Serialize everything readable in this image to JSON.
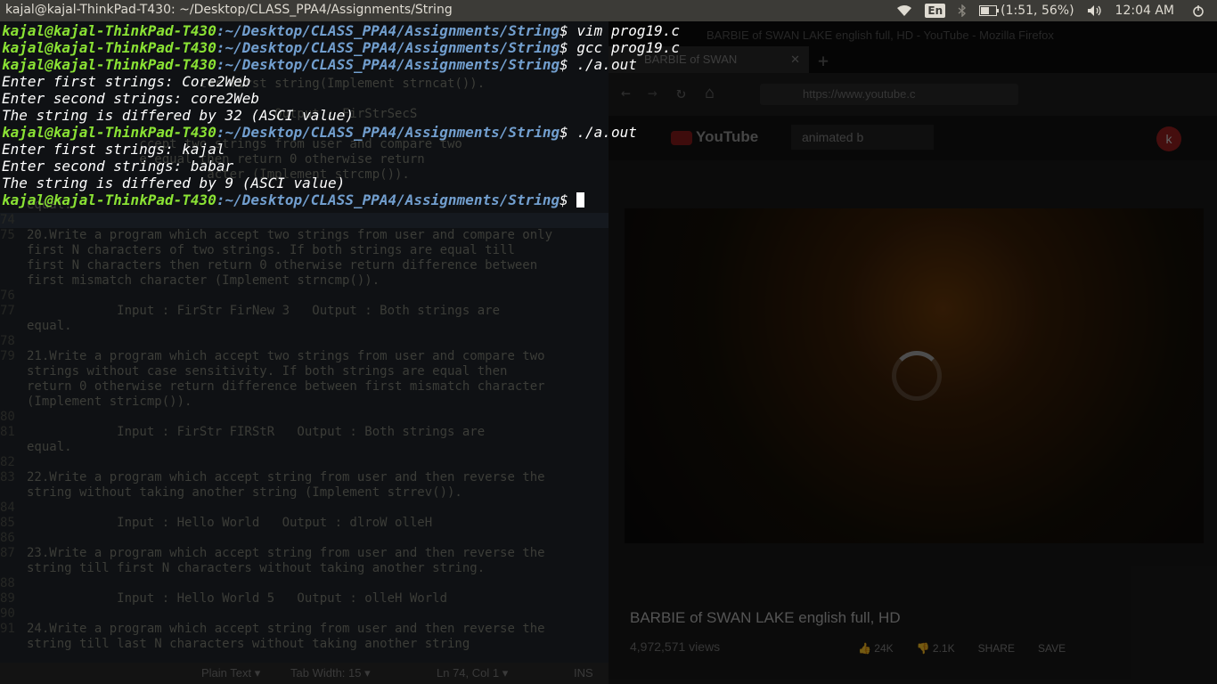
{
  "topbar": {
    "window_title": "kajal@kajal-ThinkPad-T430: ~/Desktop/CLASS_PPA4/Assignments/String",
    "keyboard_lang": "En",
    "battery": "(1:51, 56%)",
    "battery_level": 0.56,
    "clock": "12:04 AM"
  },
  "terminal": {
    "prompt_user": "kajal@kajal-ThinkPad-T430",
    "prompt_path": ":~/Desktop/CLASS_PPA4/Assignments/String",
    "prompt_sign": "$ ",
    "lines": [
      {
        "type": "prompt",
        "cmd": "vim prog19.c"
      },
      {
        "type": "prompt",
        "cmd": "gcc prog19.c"
      },
      {
        "type": "prompt",
        "cmd": "./a.out"
      },
      {
        "type": "output",
        "text": "Enter first strings: Core2Web"
      },
      {
        "type": "output",
        "text": "Enter second strings: core2Web"
      },
      {
        "type": "output",
        "text": "The string is differed by 32 (ASCI value)"
      },
      {
        "type": "prompt",
        "cmd": "./a.out"
      },
      {
        "type": "output",
        "text": "Enter first strings: kajal"
      },
      {
        "type": "output",
        "text": "Enter second strings: babar"
      },
      {
        "type": "output",
        "text": "The string is differed by 9 (ASCI value)"
      },
      {
        "type": "prompt",
        "cmd": ""
      }
    ]
  },
  "editor": {
    "lines": [
      {
        "num": "",
        "text": "                          ter first string(Implement strncat())."
      },
      {
        "num": "",
        "text": ""
      },
      {
        "num": "",
        "text": "                                    Output : FirStrSecS"
      },
      {
        "num": "",
        "text": ""
      },
      {
        "num": "",
        "text": "                  ccept two strings from user and compare two"
      },
      {
        "num": "",
        "text": "                  e equal then return 0 otherwise return"
      },
      {
        "num": "",
        "text": "                           acter (Implement strcmp())."
      },
      {
        "num": "",
        "text": ""
      },
      {
        "num": "",
        "text": "   equal."
      },
      {
        "num": "74",
        "text": ""
      },
      {
        "num": "75",
        "text": "   20.Write a program which accept two strings from user and compare only"
      },
      {
        "num": "",
        "text": "   first N characters of two strings. If both strings are equal till"
      },
      {
        "num": "",
        "text": "   first N characters then return 0 otherwise return difference between"
      },
      {
        "num": "",
        "text": "   first mismatch character (Implement strncmp())."
      },
      {
        "num": "76",
        "text": ""
      },
      {
        "num": "77",
        "text": "               Input : FirStr FirNew 3   Output : Both strings are"
      },
      {
        "num": "",
        "text": "   equal."
      },
      {
        "num": "78",
        "text": ""
      },
      {
        "num": "79",
        "text": "   21.Write a program which accept two strings from user and compare two"
      },
      {
        "num": "",
        "text": "   strings without case sensitivity. If both strings are equal then"
      },
      {
        "num": "",
        "text": "   return 0 otherwise return difference between first mismatch character"
      },
      {
        "num": "",
        "text": "   (Implement stricmp())."
      },
      {
        "num": "80",
        "text": ""
      },
      {
        "num": "81",
        "text": "               Input : FirStr FIRStR   Output : Both strings are"
      },
      {
        "num": "",
        "text": "   equal."
      },
      {
        "num": "82",
        "text": ""
      },
      {
        "num": "83",
        "text": "   22.Write a program which accept string from user and then reverse the"
      },
      {
        "num": "",
        "text": "   string without taking another string (Implement strrev())."
      },
      {
        "num": "84",
        "text": ""
      },
      {
        "num": "85",
        "text": "               Input : Hello World   Output : dlroW olleH"
      },
      {
        "num": "86",
        "text": ""
      },
      {
        "num": "87",
        "text": "   23.Write a program which accept string from user and then reverse the"
      },
      {
        "num": "",
        "text": "   string till first N characters without taking another string."
      },
      {
        "num": "88",
        "text": ""
      },
      {
        "num": "89",
        "text": "               Input : Hello World 5   Output : olleH World"
      },
      {
        "num": "90",
        "text": ""
      },
      {
        "num": "91",
        "text": "   24.Write a program which accept string from user and then reverse the"
      },
      {
        "num": "",
        "text": "   string till last N characters without taking another string"
      }
    ],
    "status": {
      "mode": "Plain Text ▾",
      "tab": "Tab Width: 15 ▾",
      "pos": "Ln 74, Col 1 ▾",
      "ins": "INS"
    }
  },
  "browser": {
    "window_title": "BARBIE of SWAN LAKE english full, HD - YouTube - Mozilla Firefox",
    "tab_title": "BARBIE of SWAN",
    "url": "https://www.youtube.c",
    "yt_logo": "YouTube",
    "search_text": "animated b",
    "avatar_letter": "k",
    "video_title": "BARBIE of SWAN LAKE english full, HD",
    "views": "4,972,571 views",
    "likes": "24K",
    "dislikes": "2.1K",
    "share": "SHARE",
    "save": "SAVE"
  }
}
